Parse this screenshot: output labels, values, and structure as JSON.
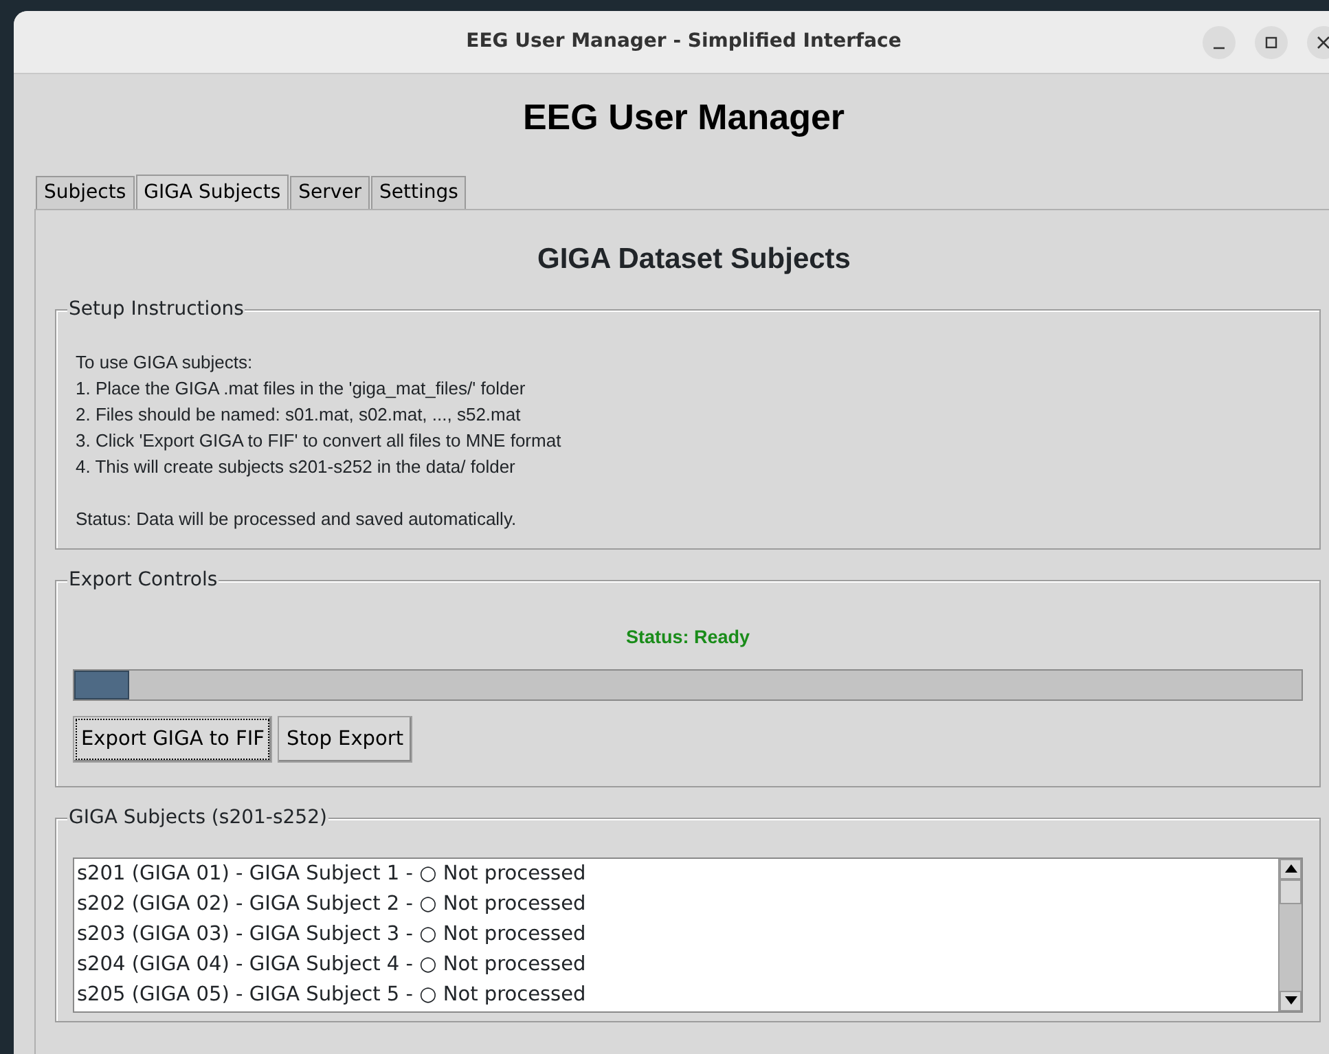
{
  "window": {
    "title": "EEG User Manager - Simplified Interface"
  },
  "app_title": "EEG User Manager",
  "tabs": [
    {
      "label": "Subjects",
      "selected": false
    },
    {
      "label": "GIGA Subjects",
      "selected": true
    },
    {
      "label": "Server",
      "selected": false
    },
    {
      "label": "Settings",
      "selected": false
    }
  ],
  "page_title": "GIGA Dataset Subjects",
  "setup": {
    "title": "Setup Instructions",
    "lines": [
      "To use GIGA subjects:",
      "1. Place the GIGA .mat files in the 'giga_mat_files/' folder",
      "2. Files should be named: s01.mat, s02.mat, ..., s52.mat",
      "3. Click 'Export GIGA to FIF' to convert all files to MNE format",
      "4. This will create subjects s201-s252 in the data/ folder"
    ],
    "note": "Status: Data will be processed and saved automatically."
  },
  "export": {
    "title": "Export Controls",
    "status": "Status: Ready",
    "status_ok": true,
    "progress": {
      "level": 0.045
    },
    "buttons": [
      {
        "label": "Export GIGA to FIF",
        "focused": true
      },
      {
        "label": "Stop Export",
        "focused": false
      }
    ]
  },
  "subjects": {
    "title": "GIGA Subjects (s201-s252)",
    "items": [
      "s201 (GIGA 01) - GIGA Subject 1 - ○ Not processed",
      "s202 (GIGA 02) - GIGA Subject 2 - ○ Not processed",
      "s203 (GIGA 03) - GIGA Subject 3 - ○ Not processed",
      "s204 (GIGA 04) - GIGA Subject 4 - ○ Not processed",
      "s205 (GIGA 05) - GIGA Subject 5 - ○ Not processed"
    ]
  }
}
